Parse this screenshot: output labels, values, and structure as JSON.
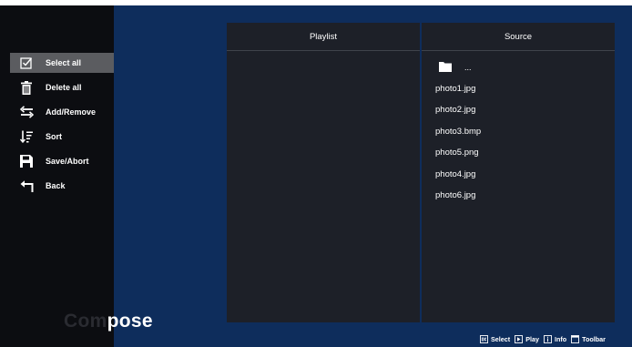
{
  "sidebar": {
    "menu": [
      {
        "icon": "checkbox-icon",
        "label": "Select all",
        "selected": true
      },
      {
        "icon": "trash-icon",
        "label": "Delete all",
        "selected": false
      },
      {
        "icon": "swap-arrows-icon",
        "label": "Add/Remove",
        "selected": false
      },
      {
        "icon": "sort-icon",
        "label": "Sort",
        "selected": false
      },
      {
        "icon": "save-icon",
        "label": "Save/Abort",
        "selected": false
      },
      {
        "icon": "back-arrow-icon",
        "label": "Back",
        "selected": false
      }
    ],
    "title_dim": "Com",
    "title_bright": "pose"
  },
  "playlist": {
    "header": "Playlist",
    "items": []
  },
  "source": {
    "header": "Source",
    "parent_folder_label": "...",
    "items": [
      "photo1.jpg",
      "photo2.jpg",
      "photo3.bmp",
      "photo5.png",
      "photo4.jpg",
      "photo6.jpg"
    ]
  },
  "hints": [
    {
      "icon": "ok-key-icon",
      "label": "Select"
    },
    {
      "icon": "play-key-icon",
      "label": "Play"
    },
    {
      "icon": "info-key-icon",
      "label": "Info"
    },
    {
      "icon": "toolbar-key-icon",
      "label": "Toolbar"
    }
  ],
  "colors": {
    "background": "#0e2d5c",
    "sidebar": "#0c0d11",
    "panel": "#1d2028",
    "selected_item": "#5b5c60",
    "text": "#ffffff"
  }
}
